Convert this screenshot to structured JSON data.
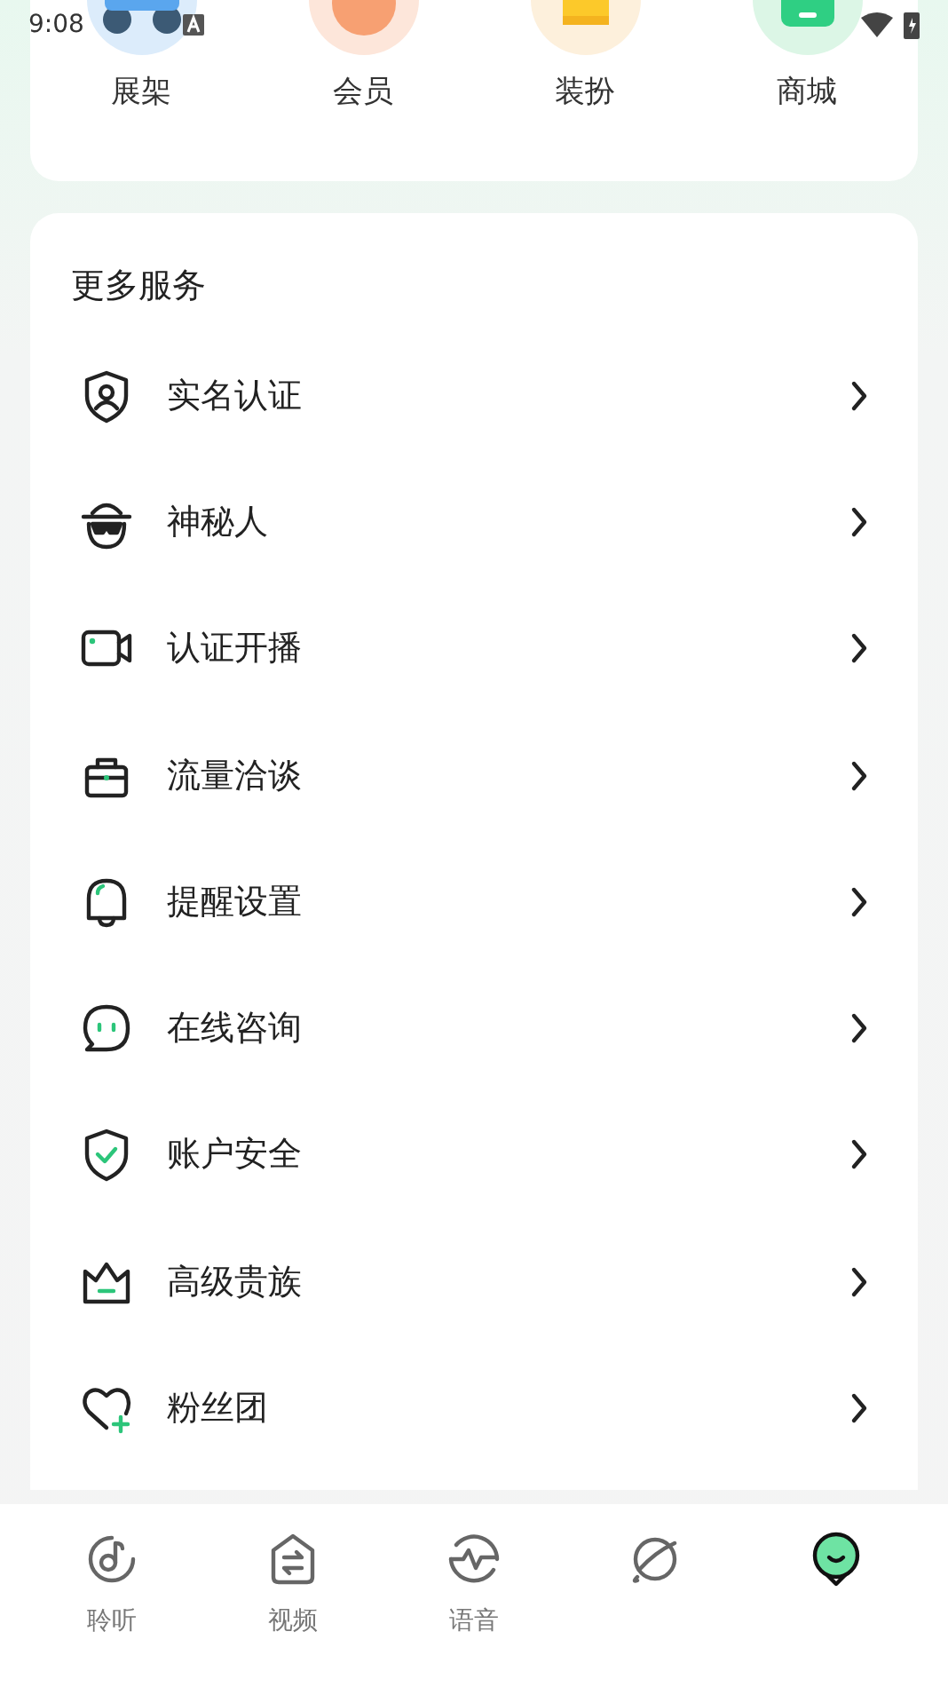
{
  "status_bar": {
    "time": "9:08"
  },
  "shortcuts": [
    {
      "label": "展架",
      "kind": "shelf"
    },
    {
      "label": "会员",
      "kind": "vip"
    },
    {
      "label": "装扮",
      "kind": "dress"
    },
    {
      "label": "商城",
      "kind": "shop"
    }
  ],
  "services": {
    "title": "更多服务",
    "items": [
      {
        "label": "实名认证",
        "kind": "id"
      },
      {
        "label": "神秘人",
        "kind": "mystery"
      },
      {
        "label": "认证开播",
        "kind": "camera"
      },
      {
        "label": "流量洽谈",
        "kind": "briefcase"
      },
      {
        "label": "提醒设置",
        "kind": "bell"
      },
      {
        "label": "在线咨询",
        "kind": "chat"
      },
      {
        "label": "账户安全",
        "kind": "shield"
      },
      {
        "label": "高级贵族",
        "kind": "crown"
      },
      {
        "label": "粉丝团",
        "kind": "heart"
      }
    ]
  },
  "tabs": [
    {
      "label": "聆听",
      "kind": "music",
      "selected": false
    },
    {
      "label": "视频",
      "kind": "video",
      "selected": false
    },
    {
      "label": "语音",
      "kind": "wave",
      "selected": false
    },
    {
      "kind": "planet",
      "selected": false
    },
    {
      "kind": "me",
      "selected": true
    }
  ]
}
